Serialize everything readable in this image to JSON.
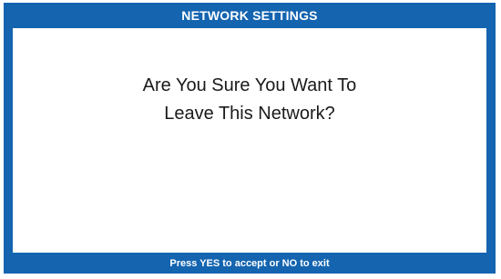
{
  "dialog": {
    "title": "NETWORK SETTINGS",
    "message_line1": "Are You Sure You Want To",
    "message_line2": "Leave This Network?",
    "footer": "Press YES to accept or NO to exit"
  },
  "colors": {
    "frame": "#1464b0",
    "content_background": "#ffffff",
    "text": "#1a1a1a"
  }
}
